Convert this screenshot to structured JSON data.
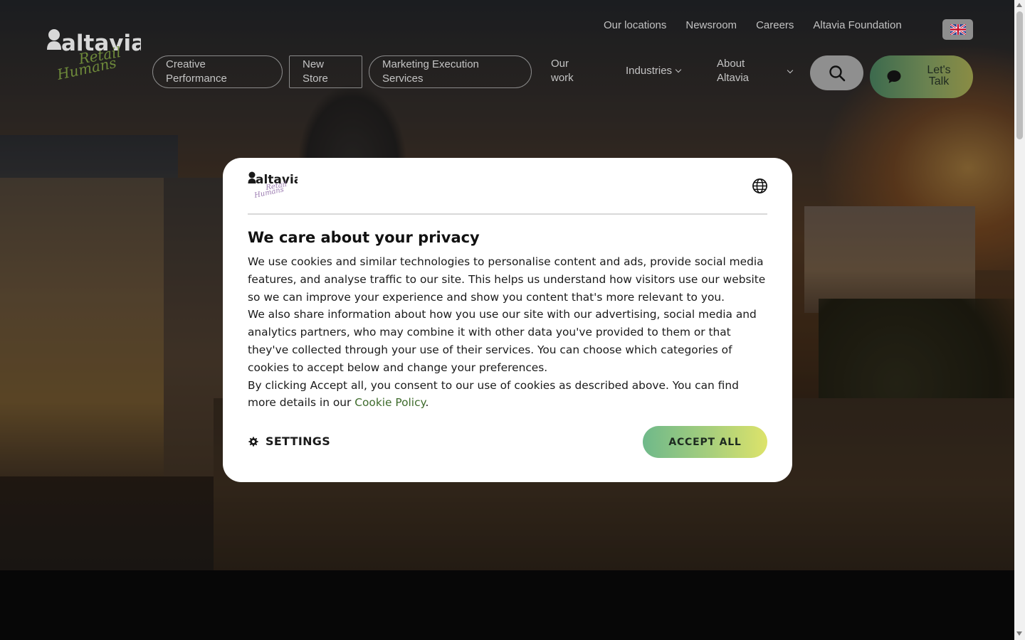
{
  "brand": {
    "logo_text": "altavia",
    "logo_script_1": "Retail",
    "logo_script_2": "Humans"
  },
  "top_nav": {
    "links": [
      "Our locations",
      "Newsroom",
      "Careers",
      "Altavia Foundation"
    ],
    "language_icon": "uk-flag-icon"
  },
  "main_nav": {
    "creative_performance": "Creative Performance",
    "new_store": "New Store",
    "marketing_execution": "Marketing Execution Services",
    "our_work": "Our work",
    "industries": "Industries",
    "about": "About Altavia",
    "search_icon": "search-icon",
    "lets_talk": "Let's Talk"
  },
  "cookie_modal": {
    "title": "We care about your privacy",
    "paragraph_1": "We use cookies and similar technologies to personalise content and ads, provide social media features, and analyse traffic to our site. This helps us understand how visitors use our website so we can improve your experience and show you content that's more relevant to you.",
    "paragraph_2": "We also share information about how you use our site with our advertising, social media and analytics partners, who may combine it with other data you've provided to them or that they've collected through your use of their services. You can choose which categories of cookies to accept below and change your preferences.",
    "paragraph_3_prefix": "By clicking Accept all, you consent to our use of cookies as described above. You can find more details in our ",
    "cookie_policy_link": "Cookie Policy",
    "paragraph_3_suffix": ".",
    "settings_label": "SETTINGS",
    "accept_label": "ACCEPT ALL",
    "language_icon": "globe-icon"
  },
  "colors": {
    "accent_gradient_start": "#6fb98a",
    "accent_gradient_end": "#dde36a",
    "link_green": "#3e6b2c"
  }
}
